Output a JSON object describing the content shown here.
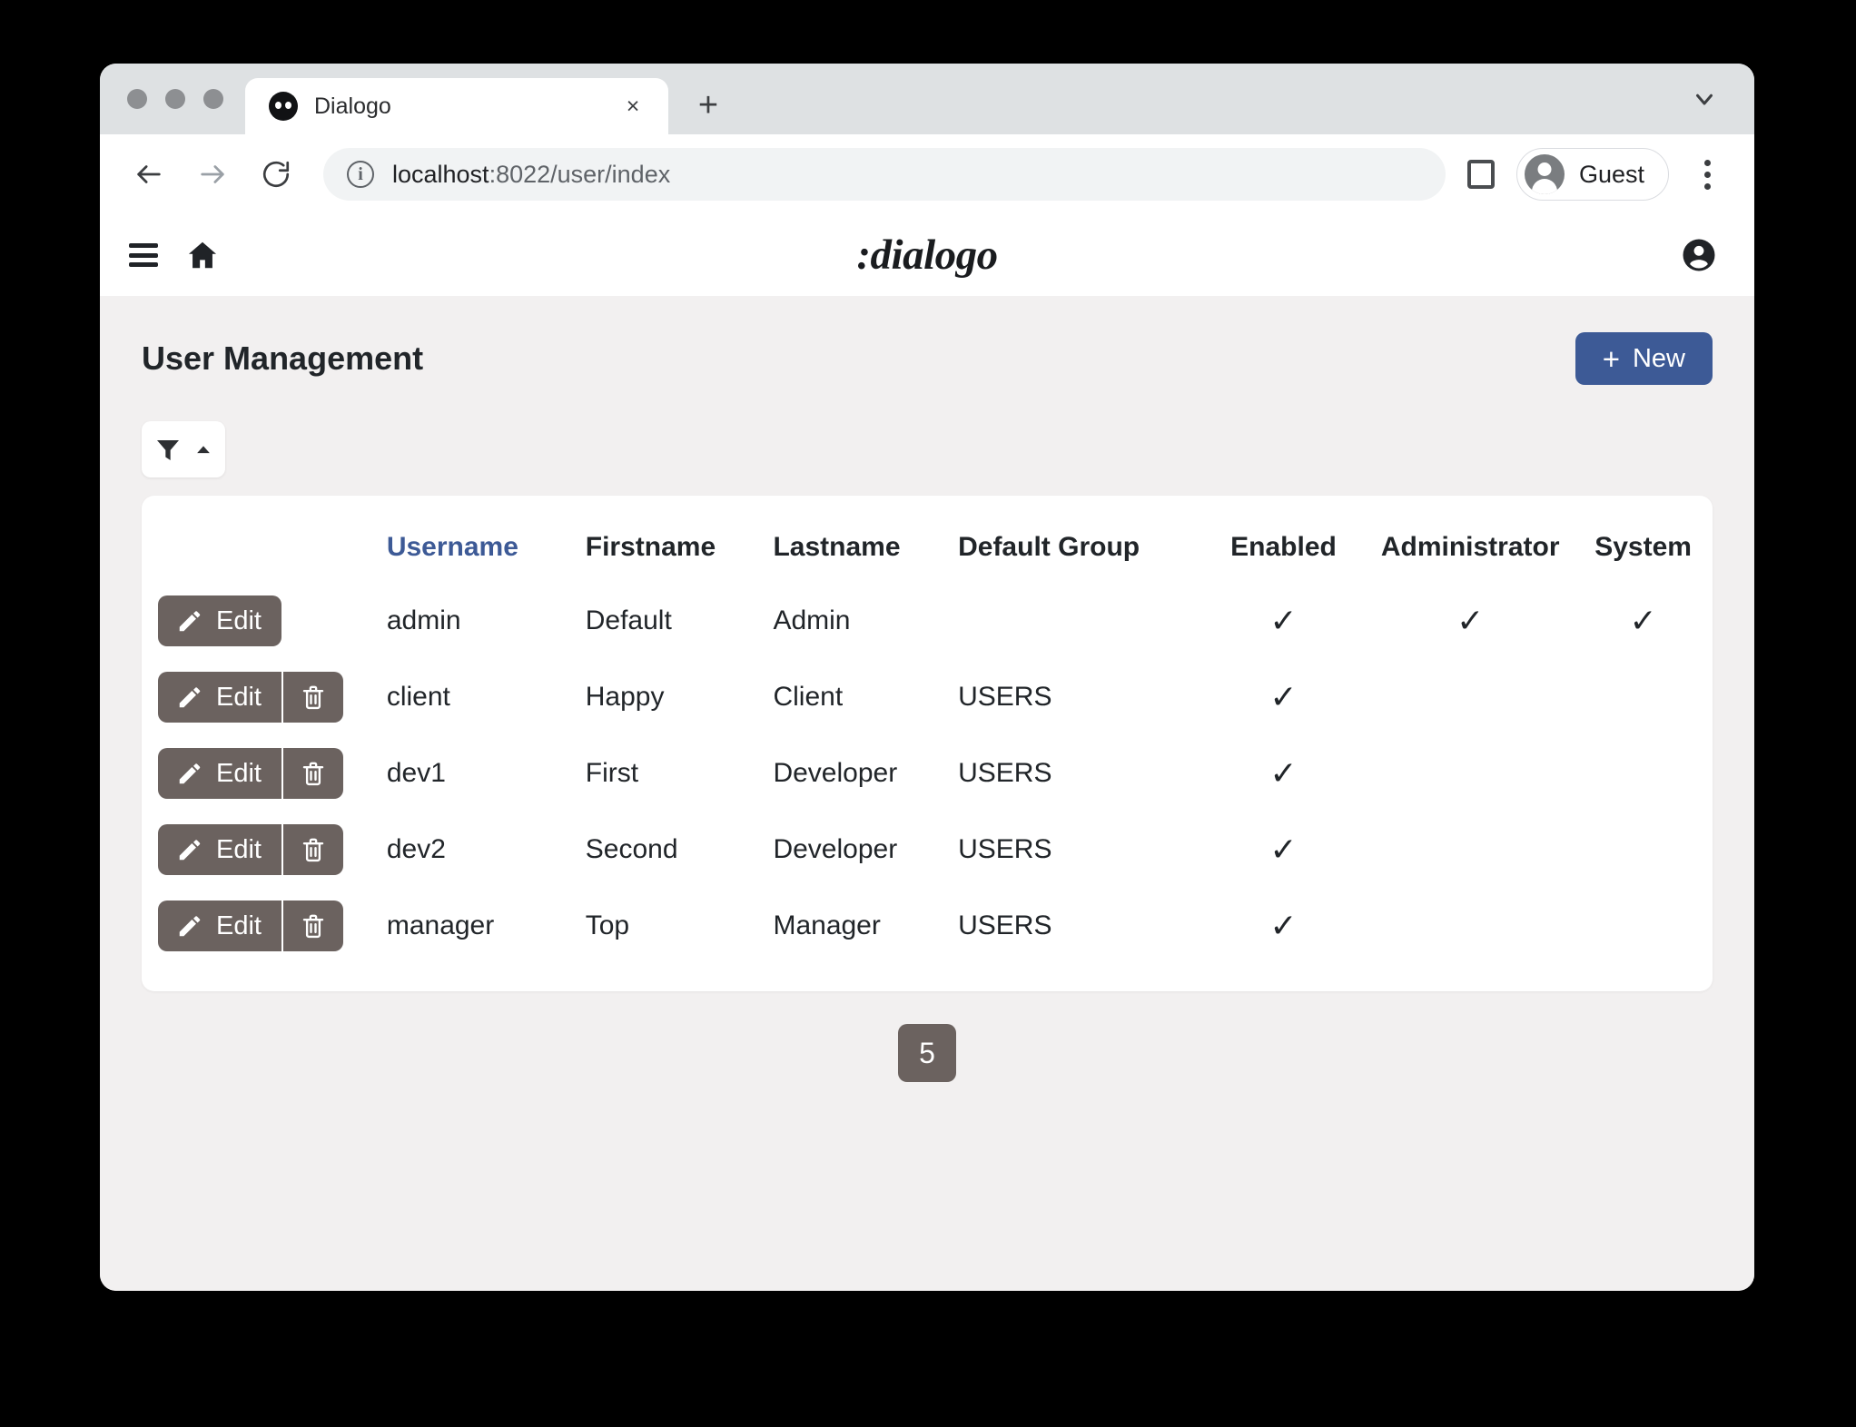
{
  "browser": {
    "tab": {
      "title": "Dialogo",
      "favicon": "dialogo-face-icon",
      "close_label": "×"
    },
    "new_tab_label": "+",
    "tabstrip_chevron": "chevron-down-icon",
    "nav": {
      "back": "←",
      "forward": "→",
      "reload": "⟳"
    },
    "omnibox": {
      "info_icon": "i",
      "url_host": "localhost",
      "url_path": ":8022/user/index"
    },
    "side_panel_icon": "side-panel-icon",
    "profile": {
      "name": "Guest"
    },
    "menu_icon": "three-dot-menu-icon"
  },
  "app_header": {
    "menu_icon": "hamburger-icon",
    "home_icon": "home-icon",
    "logo": ":dialogo",
    "account_icon": "account-circle-icon"
  },
  "page": {
    "title": "User Management",
    "new_button": {
      "label": "New",
      "plus": "+",
      "color": "#3d5a96"
    },
    "filter_button": {
      "filter_icon": "filter-funnel-icon",
      "caret_icon": "caret-up-icon"
    }
  },
  "table": {
    "columns": [
      {
        "key": "actions",
        "label": "",
        "sorted": false
      },
      {
        "key": "username",
        "label": "Username",
        "sorted": true
      },
      {
        "key": "firstname",
        "label": "Firstname",
        "sorted": false
      },
      {
        "key": "lastname",
        "label": "Lastname",
        "sorted": false
      },
      {
        "key": "group",
        "label": "Default Group",
        "sorted": false
      },
      {
        "key": "enabled",
        "label": "Enabled",
        "sorted": false
      },
      {
        "key": "administrator",
        "label": "Administrator",
        "sorted": false
      },
      {
        "key": "system",
        "label": "System",
        "sorted": false
      }
    ],
    "edit_label": "Edit",
    "check_glyph": "✓",
    "rows": [
      {
        "username": "admin",
        "firstname": "Default",
        "lastname": "Admin",
        "group": "",
        "enabled": true,
        "administrator": true,
        "system": true,
        "deletable": false
      },
      {
        "username": "client",
        "firstname": "Happy",
        "lastname": "Client",
        "group": "USERS",
        "enabled": true,
        "administrator": false,
        "system": false,
        "deletable": true
      },
      {
        "username": "dev1",
        "firstname": "First",
        "lastname": "Developer",
        "group": "USERS",
        "enabled": true,
        "administrator": false,
        "system": false,
        "deletable": true
      },
      {
        "username": "dev2",
        "firstname": "Second",
        "lastname": "Developer",
        "group": "USERS",
        "enabled": true,
        "administrator": false,
        "system": false,
        "deletable": true
      },
      {
        "username": "manager",
        "firstname": "Top",
        "lastname": "Manager",
        "group": "USERS",
        "enabled": true,
        "administrator": false,
        "system": false,
        "deletable": true
      }
    ]
  },
  "pagination": {
    "current": "5"
  }
}
